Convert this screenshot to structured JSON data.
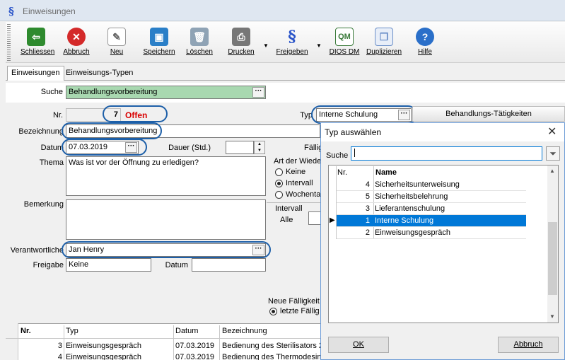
{
  "window": {
    "title": "Einweisungen",
    "app_icon": "section-sign-icon"
  },
  "toolbar": {
    "items": [
      {
        "label": "Schliessen",
        "icon": "exit-door-icon",
        "color": "#2e8a2e"
      },
      {
        "label": "Abbruch",
        "icon": "cancel-x-icon",
        "color": "#d42a2a"
      },
      {
        "label": "Neu",
        "icon": "new-page-icon",
        "color": "#d8d8d8"
      },
      {
        "label": "Speichern",
        "icon": "save-disk-icon",
        "color": "#2a7fc8"
      },
      {
        "label": "Löschen",
        "icon": "trash-icon",
        "color": "#8fa3b5"
      },
      {
        "label": "Drucken",
        "icon": "printer-icon",
        "color": "#777777"
      },
      {
        "label": "Freigeben",
        "icon": "section-sign-icon",
        "color": "#2a54c9"
      },
      {
        "label": "DIOS DM",
        "icon": "qm-pdf-icon",
        "color": "#3a7a3a"
      },
      {
        "label": "Duplizieren",
        "icon": "duplicate-icon",
        "color": "#6b8fc8"
      },
      {
        "label": "Hilfe",
        "icon": "help-icon",
        "color": "#2a6fc9"
      }
    ]
  },
  "tabs": [
    {
      "label": "Einweisungen",
      "active": true
    },
    {
      "label": "Einweisungs-Typen",
      "active": false
    }
  ],
  "form": {
    "search_label": "Suche",
    "search_value": "Behandlungsvorbereitung",
    "nr_label": "Nr.",
    "nr_value": "7",
    "status": "Offen",
    "typ_label": "Typ",
    "typ_value": "Interne Schulung",
    "bezeichnung_label": "Bezeichnung",
    "bezeichnung_value": "Behandlungsvorbereitung",
    "datum_label": "Datum",
    "datum_value": "07.03.2019",
    "dauer_label": "Dauer (Std.)",
    "dauer_value": "",
    "faellig_label": "Fällig",
    "thema_label": "Thema",
    "thema_value": "Was ist vor der Öffnung zu erledigen?",
    "art_label": "Art der Wieder",
    "radio_keine": "Keine",
    "radio_intervall": "Intervall",
    "radio_wochentag": "Wochenta",
    "bemerkung_label": "Bemerkung",
    "bemerkung_value": "",
    "intervall_label": "Intervall",
    "alle_label": "Alle",
    "verantwortliche_label": "Verantwortliche",
    "verantwortliche_value": "Jan Henry",
    "freigabe_label": "Freigabe",
    "freigabe_value": "Keine",
    "freigabe_datum_label": "Datum",
    "freigabe_datum_value": "",
    "neue_faelligkeit_label": "Neue Fälligkeit",
    "letzte_faelligkeit_label": "letzte Fällig",
    "behandlungs_button": "Behandlungs-Tätigkeiten"
  },
  "grid": {
    "columns": [
      "Nr.",
      "Typ",
      "Datum",
      "Bezeichnung"
    ],
    "rows": [
      {
        "nr": "3",
        "typ": "Einweisungsgespräch",
        "datum": "07.03.2019",
        "bez": "Bedienung des Sterilisators 2"
      },
      {
        "nr": "4",
        "typ": "Einweisungsgespräch",
        "datum": "07.03.2019",
        "bez": "Bedienung des Thermodesinfe"
      }
    ]
  },
  "dialog": {
    "title": "Typ auswählen",
    "search_label": "Suche",
    "search_value": "",
    "columns": [
      "Nr.",
      "Name"
    ],
    "rows": [
      {
        "nr": "4",
        "name": "Sicherheitsunterweisung",
        "selected": false
      },
      {
        "nr": "5",
        "name": "Sicherheitsbelehrung",
        "selected": false
      },
      {
        "nr": "3",
        "name": "Lieferantenschulung",
        "selected": false
      },
      {
        "nr": "1",
        "name": "Interne Schulung",
        "selected": true
      },
      {
        "nr": "2",
        "name": "Einweisungsgespräch",
        "selected": false
      }
    ],
    "ok_label": "OK",
    "cancel_label": "Abbruch",
    "selection_color": "#0078d7"
  },
  "highlight_color": "#1d5fa8"
}
